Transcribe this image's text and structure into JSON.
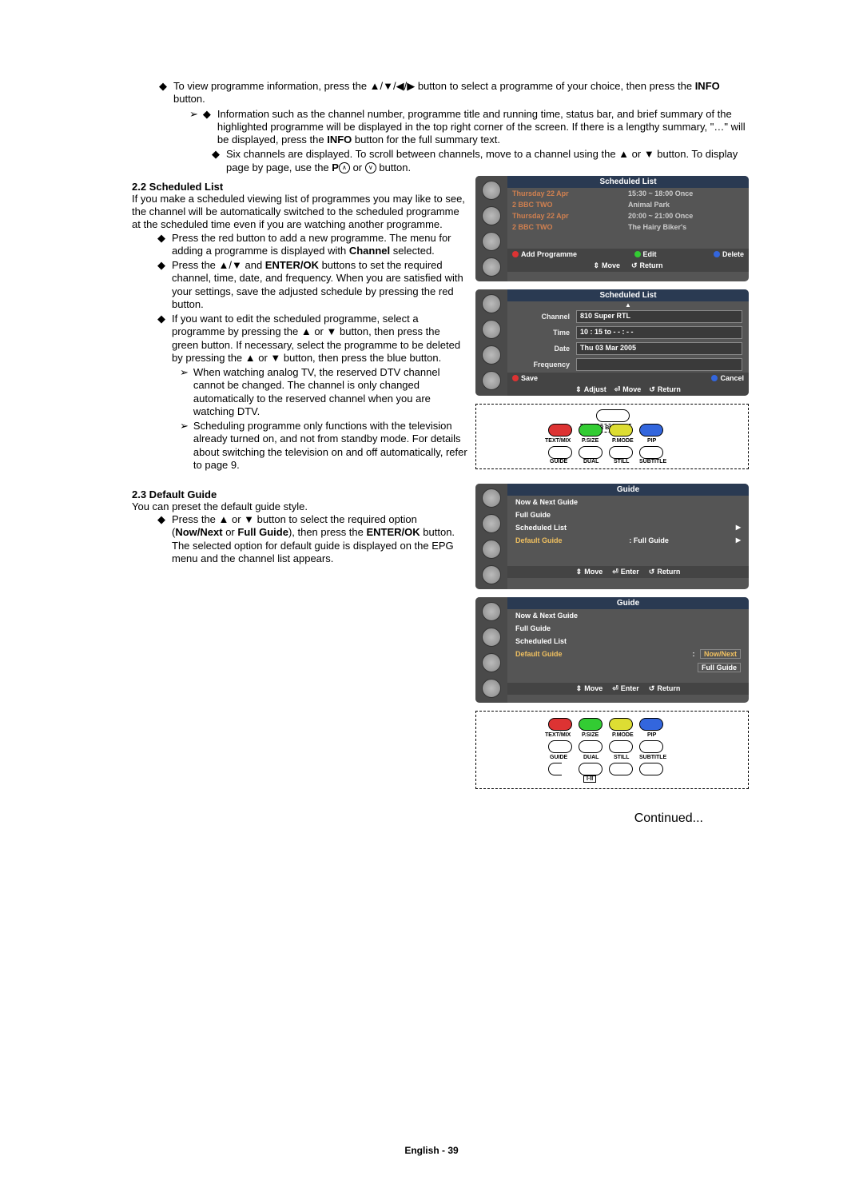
{
  "top": {
    "b1_line1": "To view programme information, press the ▲/▼/◀/▶ button to select a programme of your choice, then press the ",
    "b1_bold": "INFO",
    "b1_line1_end": " button.",
    "b1_sub1": "Information such as the channel number, programme title and running time, status bar, and brief summary of the highlighted programme will be displayed in the top right corner of the screen. If there is a lengthy summary, \"…\" will be displayed, press the ",
    "b1_sub1_bold": "INFO",
    "b1_sub1_end": " button for the full summary text.",
    "b1_sub2_a": "Six channels are displayed. To scroll between channels, move to a channel using the ▲ or ▼ button. To display page by page, use the ",
    "b1_sub2_bold": "P",
    "b1_sub2_mid": " or ",
    "b1_sub2_end": " button."
  },
  "s22": {
    "head": "2.2  Scheduled List",
    "intro": "If you make a scheduled viewing list of programmes you may like to see, the channel will be automatically switched to the scheduled programme at the scheduled time even if you are watching another programme.",
    "p1_a": "Press the red button to add a new programme. The menu for adding a programme is displayed with ",
    "p1_bold": "Channel",
    "p1_b": " selected.",
    "p2": "Press the ▲/▼ and ",
    "p2_bold": "ENTER/OK",
    "p2_b": " buttons to set the required channel, time, date, and frequency. When you are satisfied with your settings, save the adjusted schedule by pressing the red button.",
    "p3": "If you want to edit the scheduled programme, select a programme by pressing the ▲ or ▼ button, then press the green button. If necessary, select the programme to be deleted by pressing the ▲ or ▼ button, then press the blue button.",
    "p3_s1": "When watching analog TV, the reserved DTV channel cannot be changed. The channel is only changed automatically to the reserved channel when you are watching DTV.",
    "p3_s2": "Scheduling programme only functions with the television already turned on, and not from standby mode. For details about switching the television on and off automatically, refer to page 9."
  },
  "s23": {
    "head": "2.3  Default Guide",
    "intro": "You can preset the default guide style.",
    "p1_a": "Press the ▲ or ▼ button to select the required option (",
    "p1_bold1": "Now/Next",
    "p1_mid": " or ",
    "p1_bold2": "Full Guide",
    "p1_b": "), then press the ",
    "p1_bold3": "ENTER/OK",
    "p1_c": " button. The selected option for default guide is displayed on the EPG menu and the channel list appears."
  },
  "osd1": {
    "title": "Scheduled List",
    "r1a": "Thursday 22 Apr",
    "r1b": "15:30 ~ 18:00 Once",
    "r1c": "2 BBC TWO",
    "r1d": "Animal Park",
    "r2a": "Thursday 22 Apr",
    "r2b": "20:00 ~ 21:00 Once",
    "r2c": "2 BBC TWO",
    "r2d": "The Hairy Biker's",
    "add": "Add Programme",
    "edit": "Edit",
    "delete": "Delete",
    "move": "Move",
    "return": "Return"
  },
  "osd2": {
    "title": "Scheduled List",
    "channel_l": "Channel",
    "channel_v": "810 Super RTL",
    "time_l": "Time",
    "time_v": "10 : 15 to - - : - -",
    "date_l": "Date",
    "date_v": "Thu 03 Mar 2005",
    "freq_l": "Frequency",
    "freq_v": "",
    "save": "Save",
    "cancel": "Cancel",
    "adjust": "Adjust",
    "move": "Move",
    "return": "Return"
  },
  "remote1": {
    "color": "COLOR BUTTON",
    "b1": "TEXT/MIX",
    "b2": "P.SIZE",
    "b3": "P.MODE",
    "b4": "PIP",
    "b5": "GUIDE",
    "b6": "DUAL",
    "b7": "STILL",
    "b8": "SUBTITLE"
  },
  "osd3": {
    "title": "Guide",
    "i1": "Now & Next Guide",
    "i2": "Full Guide",
    "i3": "Scheduled List",
    "i4": "Default Guide",
    "i4v": ": Full Guide",
    "move": "Move",
    "enter": "Enter",
    "return": "Return"
  },
  "osd4": {
    "title": "Guide",
    "i1": "Now & Next Guide",
    "i2": "Full Guide",
    "i3": "Scheduled List",
    "i4": "Default Guide",
    "opt1": "Now/Next",
    "opt2": "Full Guide",
    "move": "Move",
    "enter": "Enter",
    "return": "Return"
  },
  "remote2": {
    "b1": "TEXT/MIX",
    "b2": "P.SIZE",
    "b3": "P.MODE",
    "b4": "PIP",
    "b5": "GUIDE",
    "b6": "DUAL",
    "b7": "STILL",
    "b8": "SUBTITLE",
    "iii": "I·II"
  },
  "continued": "Continued...",
  "footer_a": "English - ",
  "footer_b": "39"
}
